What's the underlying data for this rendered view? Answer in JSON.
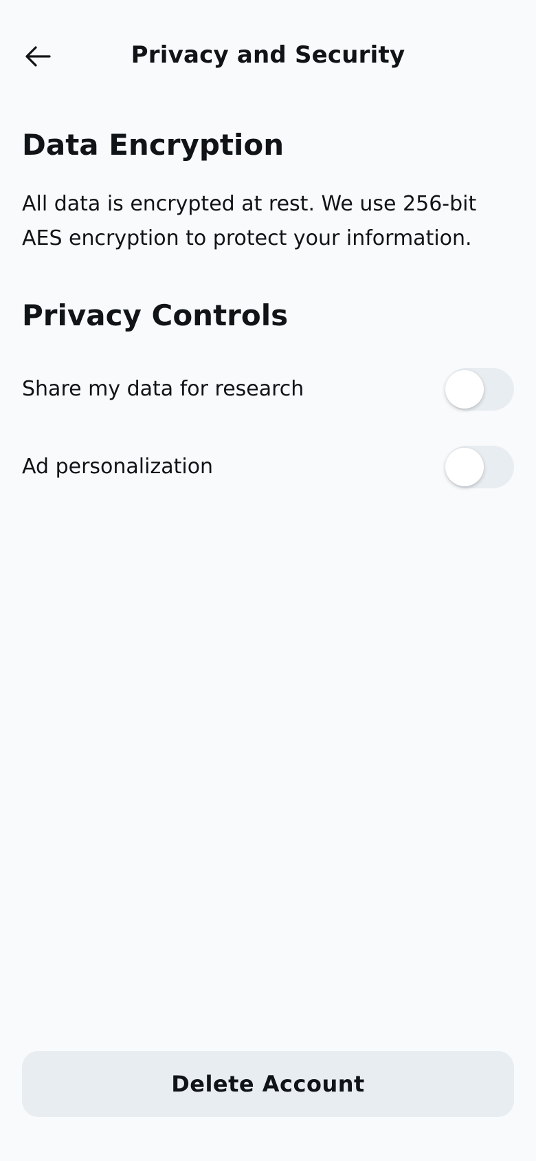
{
  "header": {
    "back_icon": "arrow-left-icon",
    "title": "Privacy and Security"
  },
  "encryption": {
    "title": "Data Encryption",
    "description": "All data is encrypted at rest. We use 256-bit AES encryption to protect your information."
  },
  "privacy_controls": {
    "title": "Privacy Controls",
    "toggles": [
      {
        "label": "Share my data for research",
        "enabled": false
      },
      {
        "label": "Ad personalization",
        "enabled": false
      }
    ]
  },
  "actions": {
    "delete_label": "Delete Account"
  },
  "colors": {
    "background": "#F8FAFC",
    "text": "#111417",
    "control_fill": "#E8EDF2",
    "knob": "#FFFFFF"
  }
}
